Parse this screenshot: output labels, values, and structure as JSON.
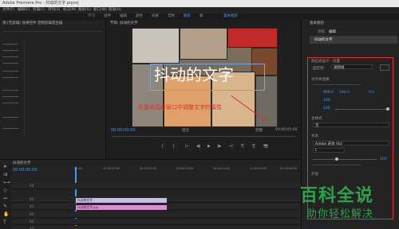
{
  "window": {
    "title": "Adobe Premiere Pro - 抖动的文字.prproj"
  },
  "menu": [
    "文件(F)",
    "编辑(E)",
    "剪辑(C)",
    "序列(S)",
    "标记(M)",
    "图形(G)",
    "窗口(W)",
    "帮助(H)"
  ],
  "workspaces": [
    "学习",
    "组件",
    "编辑",
    "颜色",
    "效果",
    "音频",
    "图形",
    "库",
    "基本图形"
  ],
  "active_workspace": "图形",
  "source_panel": {
    "title": "源:(无剪辑)  效果控件  音频剪辑混合器"
  },
  "program": {
    "title": "节目: 抖动的文字",
    "overlay_text": "抖动的文字",
    "annotation": "在基本图形窗口中调整文字的属性",
    "timecode_left": "00:00:00:00",
    "fit": "适合",
    "quality": "完整",
    "timecode_right": "00:00:05:00",
    "controls": [
      "{",
      "}",
      "|←",
      "◀|",
      "▶",
      "|▶",
      "→|",
      "⎘",
      "⎗",
      "📷"
    ]
  },
  "essential_graphics": {
    "title": "基本图形",
    "tabs": [
      "浏览",
      "编辑"
    ],
    "layer": "抖动的文字",
    "section_responsive": "响应式设计 - 位置",
    "pin_label": "固定到",
    "pin_value": "视频帧",
    "section_align": "对齐并变换",
    "values": [
      "960.0",
      "540.0",
      "100",
      "0.0",
      "100"
    ],
    "section_master": "主样式",
    "master_value": "无",
    "section_text": "文本",
    "font": "Adobe 宋体 Std",
    "font_style": "L",
    "font_size": "100",
    "section_appearance": "外观"
  },
  "timeline": {
    "title": "抖动的文字",
    "timecode": "00:00:00:00",
    "ruler": [
      "00:00",
      "00:00:01:00",
      "00:00:02:00",
      "00:00:03:00",
      "00:00:04:00",
      "00:00:05:00",
      "00:00:06:00"
    ],
    "tracks": [
      "V3",
      "V2",
      "V1",
      "A1",
      "A2",
      "A3"
    ],
    "clips": [
      {
        "name": "抖动的文字",
        "track": "V2"
      },
      {
        "name": "抖动的文字.jpg",
        "track": "V1"
      }
    ]
  },
  "watermark": {
    "title": "百科全说",
    "subtitle": "助你轻松解决"
  },
  "colors": {
    "accent": "#3d9df5",
    "annotation_red": "#e03030",
    "clip_lilac": "#c2c0e6",
    "clip_pink": "#e28ad8",
    "watermark_green": "#2aa34a"
  }
}
